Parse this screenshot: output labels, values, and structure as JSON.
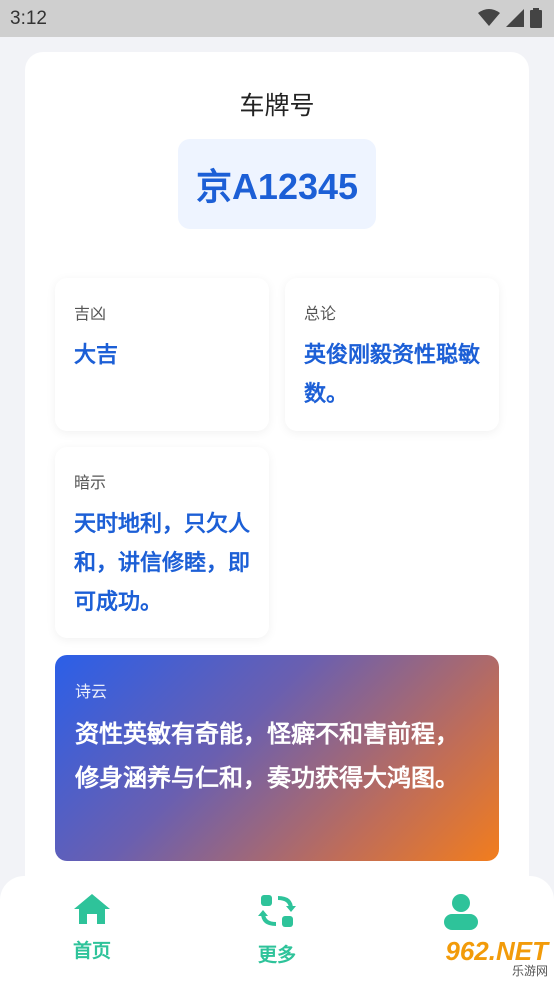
{
  "status_bar": {
    "time": "3:12"
  },
  "header": {
    "title": "车牌号",
    "plate": "京A12345"
  },
  "cards": {
    "luck": {
      "label": "吉凶",
      "value": "大吉"
    },
    "summary": {
      "label": "总论",
      "value": "英俊刚毅资性聪敏数。"
    },
    "hint": {
      "label": "暗示",
      "value": "天时地利，只欠人和，讲信修睦，即可成功。"
    }
  },
  "poem": {
    "label": "诗云",
    "text": "资性英敏有奇能，怪癖不和害前程，修身涵养与仁和，奏功获得大鸿图。"
  },
  "bottom_nav": {
    "items": [
      {
        "label": "首页",
        "icon": "home-icon"
      },
      {
        "label": "更多",
        "icon": "refresh-swap-icon"
      },
      {
        "label": "",
        "icon": "profile-icon"
      }
    ]
  },
  "watermark": {
    "logo": "962.NET",
    "sub": "乐游网"
  },
  "colors": {
    "accent": "#1c5fd6",
    "nav_green": "#2ec39a",
    "gradient_start": "#2b5fe8",
    "gradient_end": "#f27d1d"
  }
}
